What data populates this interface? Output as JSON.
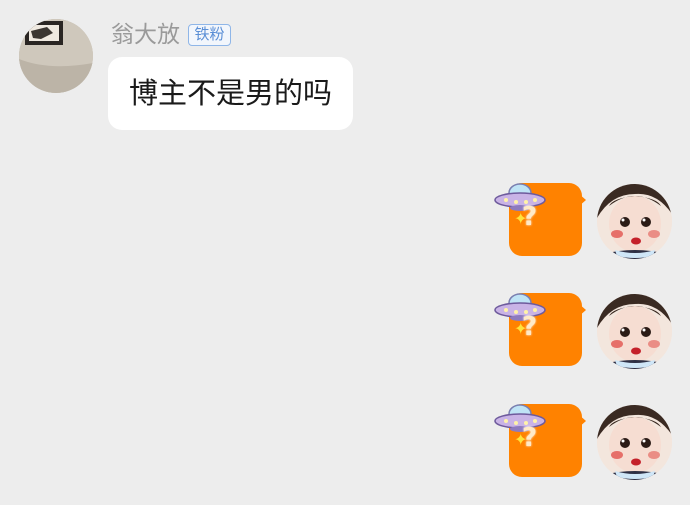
{
  "incoming": {
    "sender_name": "翁大放",
    "badge": "铁粉",
    "message": "博主不是男的吗",
    "avatar_icon": "sender-avatar"
  },
  "outgoing": [
    {
      "sticker": "ufo-question-sticker",
      "mark": "?"
    },
    {
      "sticker": "ufo-question-sticker",
      "mark": "?"
    },
    {
      "sticker": "ufo-question-sticker",
      "mark": "?"
    }
  ],
  "colors": {
    "background": "#ededed",
    "sticker_bubble": "#ff8200",
    "badge_border": "#8fb6e8",
    "badge_text": "#5b8fd6",
    "name_text": "#9a9a9a"
  }
}
